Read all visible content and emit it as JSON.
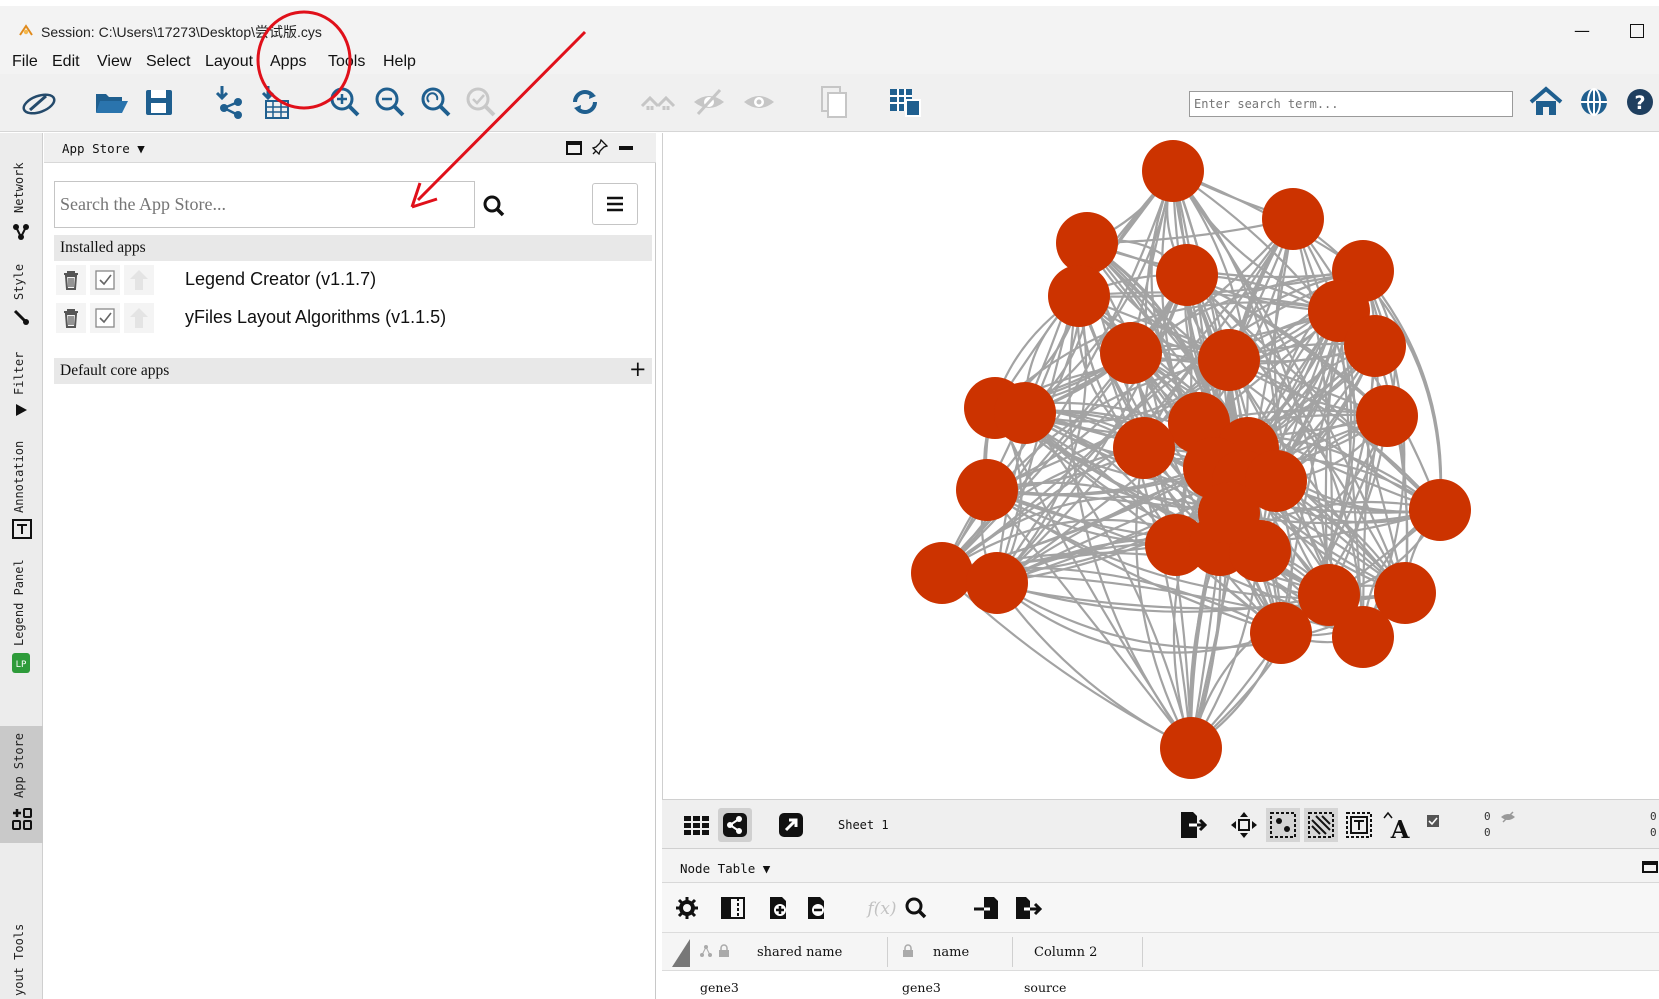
{
  "window": {
    "title": "Session: C:\\Users\\17273\\Desktop\\尝试版.cys",
    "minimize_symbol": "—"
  },
  "menu": {
    "items": [
      "File",
      "Edit",
      "View",
      "Select",
      "Layout",
      "Apps",
      "Tools",
      "Help"
    ]
  },
  "toolbar": {
    "icons": [
      "cytoscape-logo-icon",
      "open-folder-icon",
      "save-icon",
      "import-network-icon",
      "import-table-icon",
      "zoom-in-icon",
      "zoom-out-icon",
      "zoom-fit-icon",
      "zoom-selected-icon",
      "refresh-icon",
      "show-all-icon",
      "hide-icon",
      "show-icon",
      "new-network-icon",
      "table-layout-icon",
      "home-icon",
      "globe-icon",
      "help-icon"
    ],
    "search_placeholder": "Enter search term..."
  },
  "side_tabs": [
    {
      "label": "Network",
      "icon": "network-icon"
    },
    {
      "label": "Style",
      "icon": "brush-icon"
    },
    {
      "label": "Filter",
      "icon": "filter-icon"
    },
    {
      "label": "Annotation",
      "icon": "annotation-icon"
    },
    {
      "label": "Legend Panel",
      "icon": "legend-panel-icon"
    },
    {
      "label": "App Store",
      "icon": "app-store-icon",
      "active": true
    },
    {
      "label": "yout Tools",
      "icon": ""
    }
  ],
  "app_store": {
    "panel_title": "App Store ▼",
    "search_placeholder": "Search the App Store...",
    "installed_label": "Installed apps",
    "installed": [
      {
        "name": "Legend Creator (v1.1.7)",
        "enabled": true
      },
      {
        "name": "yFiles Layout Algorithms (v1.1.5)",
        "enabled": true
      }
    ],
    "core_label": "Default core apps",
    "core_action": "+"
  },
  "network": {
    "node_color": "#cc3300",
    "edge_color": "#a3a3a3",
    "sheet_label": "Sheet 1",
    "counts_a": [
      "0",
      "0"
    ],
    "counts_b": [
      "0",
      "0"
    ]
  },
  "node_table": {
    "title": "Node Table ▼",
    "columns": [
      "shared name",
      "name",
      "Column 2"
    ],
    "rows": [
      [
        "gene3",
        "gene3",
        "source"
      ]
    ]
  },
  "annotation": {
    "circle_color": "#e0101a",
    "arrow_color": "#e0101a"
  }
}
